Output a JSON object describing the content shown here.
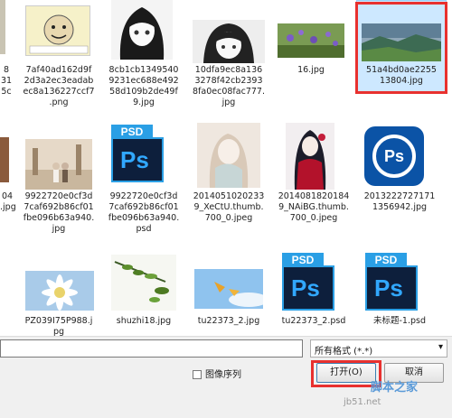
{
  "files": [
    {
      "caption": "8\n31\n5c",
      "kind": "partial"
    },
    {
      "caption": "7af40ad162d9f\n2d3a2ec3eadab\nec8a136227ccf7\n.png",
      "kind": "meme"
    },
    {
      "caption": "8cb1cb1349540\n9231ec688e492\n58d109b2de49f\n9.jpg",
      "kind": "anime-bw"
    },
    {
      "caption": "10dfa9ec8a136\n3278f42cb2393\n8fa0ec08fac777.\njpg",
      "kind": "anime-bw2"
    },
    {
      "caption": "16.jpg",
      "kind": "flowers"
    },
    {
      "caption": "51a4bd0ae2255\n13804.jpg",
      "kind": "landscape"
    },
    {
      "caption": "04\n.jpg",
      "kind": "partial"
    },
    {
      "caption": "9922720e0cf3d\n7caf692b86cf01\nfbe096b63a940.\njpg",
      "kind": "wedding"
    },
    {
      "caption": "9922720e0cf3d\n7caf692b86cf01\nfbe096b63a940.\npsd",
      "kind": "psd"
    },
    {
      "caption": "2014051020233\n9_XeCtU.thumb.\n700_0.jpeg",
      "kind": "anime-pale"
    },
    {
      "caption": "2014081820184\n9_NAiBG.thumb.\n700_0.jpeg",
      "kind": "anime-red"
    },
    {
      "caption": "2013222727171\n1356942.jpg",
      "kind": "psx"
    },
    {
      "caption": "PZ039I75P988.j\npg",
      "kind": "daisy"
    },
    {
      "caption": "shuzhi18.jpg",
      "kind": "leaves"
    },
    {
      "caption": "tu22373_2.jpg",
      "kind": "sky"
    },
    {
      "caption": "tu22373_2.psd",
      "kind": "psd"
    },
    {
      "caption": "未标题-1.psd",
      "kind": "psd"
    }
  ],
  "psd_label": "PSD",
  "ps_label": "Ps",
  "filter": {
    "value": "所有格式 (*.*)",
    "arrow": "▾"
  },
  "checkbox_label": "图像序列",
  "open_button": "打开(O)",
  "cancel_button": "取消",
  "watermark": "脚本之家",
  "watermark_url": "jb51.net",
  "colors": {
    "selection": "#cde8ff",
    "highlight": "#e8312f",
    "psd_blue": "#2a9fe5"
  }
}
